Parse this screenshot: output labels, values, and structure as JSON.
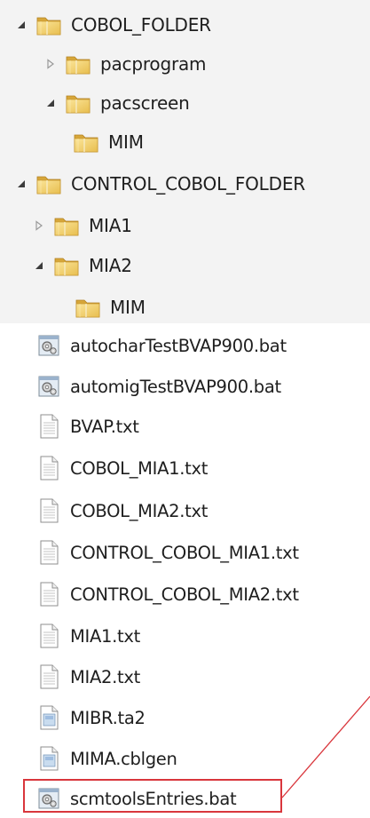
{
  "tree": {
    "items": [
      {
        "label": "COBOL_FOLDER",
        "state": "expanded"
      },
      {
        "label": "pacprogram",
        "state": "collapsed"
      },
      {
        "label": "pacscreen",
        "state": "expanded"
      },
      {
        "label": "MIM",
        "state": "none"
      },
      {
        "label": "CONTROL_COBOL_FOLDER",
        "state": "expanded"
      },
      {
        "label": "MIA1",
        "state": "collapsed"
      },
      {
        "label": "MIA2",
        "state": "expanded"
      },
      {
        "label": "MIM",
        "state": "none"
      }
    ]
  },
  "files": {
    "items": [
      {
        "label": "autocharTestBVAP900.bat",
        "icon": "batch-file-icon"
      },
      {
        "label": "automigTestBVAP900.bat",
        "icon": "batch-file-icon"
      },
      {
        "label": "BVAP.txt",
        "icon": "text-file-icon"
      },
      {
        "label": "COBOL_MIA1.txt",
        "icon": "text-file-icon"
      },
      {
        "label": "COBOL_MIA2.txt",
        "icon": "text-file-icon"
      },
      {
        "label": "CONTROL_COBOL_MIA1.txt",
        "icon": "text-file-icon"
      },
      {
        "label": "CONTROL_COBOL_MIA2.txt",
        "icon": "text-file-icon"
      },
      {
        "label": "MIA1.txt",
        "icon": "text-file-icon"
      },
      {
        "label": "MIA2.txt",
        "icon": "text-file-icon"
      },
      {
        "label": "MIBR.ta2",
        "icon": "generic-file-icon"
      },
      {
        "label": "MIMA.cblgen",
        "icon": "generic-file-icon"
      },
      {
        "label": "scmtoolsEntries.bat",
        "icon": "batch-file-icon"
      }
    ]
  },
  "colors": {
    "tree_background": "#f3f3f3",
    "highlight": "#d9363c",
    "folder": "#e8c25a"
  }
}
